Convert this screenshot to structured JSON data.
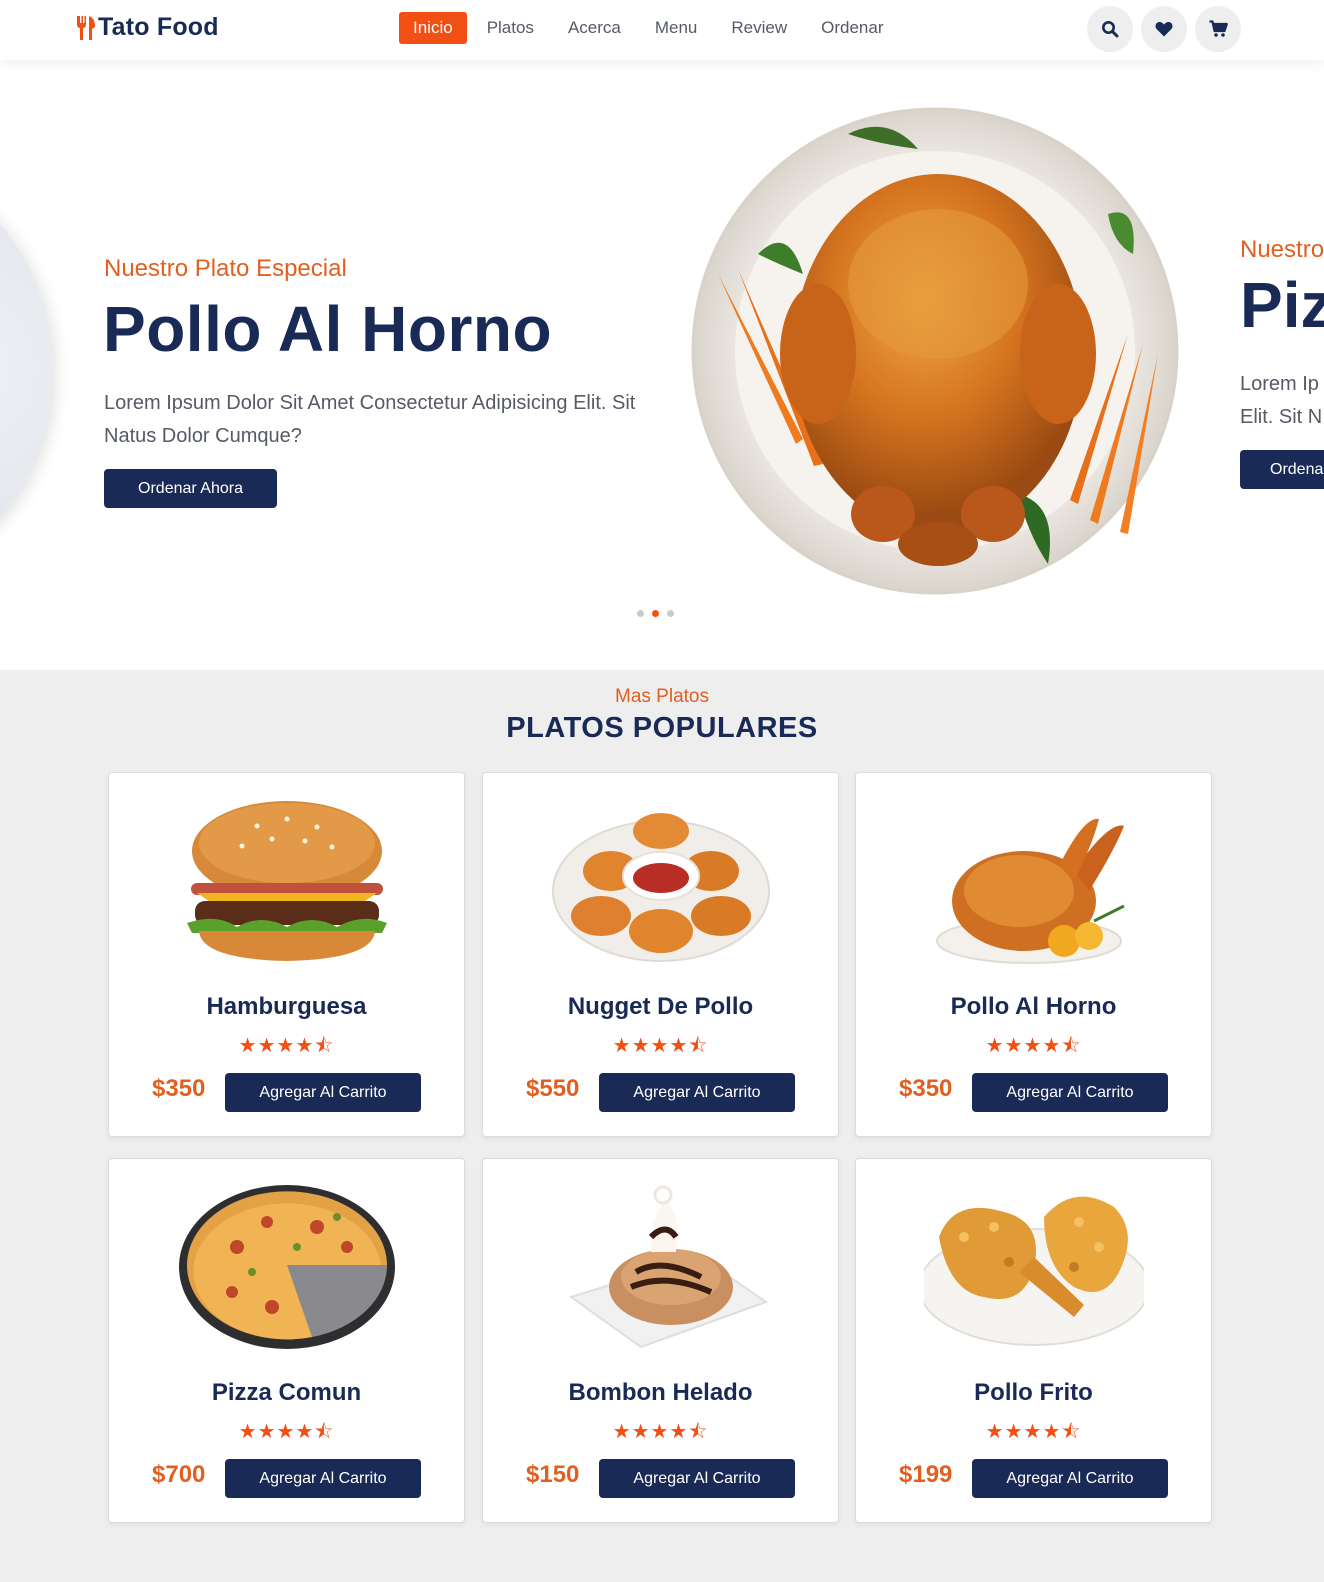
{
  "header": {
    "brand": "Tato Food",
    "nav": [
      "Inicio",
      "Platos",
      "Acerca",
      "Menu",
      "Review",
      "Ordenar"
    ],
    "active_index": 0,
    "icons": [
      "search-icon",
      "heart-icon",
      "cart-icon"
    ]
  },
  "hero": {
    "subtitle": "Nuestro Plato Especial",
    "title": "Pollo Al Horno",
    "description": "Lorem Ipsum Dolor Sit Amet Consectetur Adipisicing Elit. Sit Natus Dolor Cumque?",
    "button": "Ordenar Ahora",
    "next_slide": {
      "subtitle": "Nuestro",
      "title": "Piz",
      "desc_line1": "Lorem Ip",
      "desc_line2": "Elit. Sit N",
      "button": "Ordena"
    },
    "slides_count": 3,
    "active_slide": 1
  },
  "section": {
    "subtitle": "Mas Platos",
    "title": "PLATOS POPULARES"
  },
  "dishes": [
    {
      "name": "Hamburguesa",
      "price": "$350",
      "rating": 4.5,
      "button": "Agregar Al Carrito"
    },
    {
      "name": "Nugget De Pollo",
      "price": "$550",
      "rating": 4.5,
      "button": "Agregar Al Carrito"
    },
    {
      "name": "Pollo Al Horno",
      "price": "$350",
      "rating": 4.5,
      "button": "Agregar Al Carrito"
    },
    {
      "name": "Pizza Comun",
      "price": "$700",
      "rating": 4.5,
      "button": "Agregar Al Carrito"
    },
    {
      "name": "Bombon Helado",
      "price": "$150",
      "rating": 4.5,
      "button": "Agregar Al Carrito"
    },
    {
      "name": "Pollo Frito",
      "price": "$199",
      "rating": 4.5,
      "button": "Agregar Al Carrito"
    }
  ],
  "colors": {
    "accent": "#f24f15",
    "dark": "#192a56",
    "background": "#eeeeee"
  }
}
